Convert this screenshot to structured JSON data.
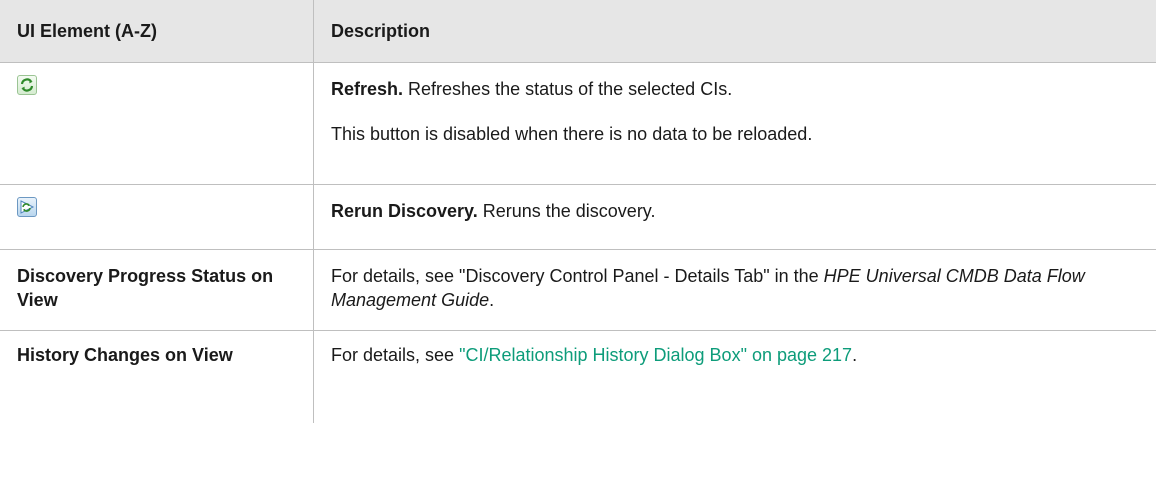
{
  "header": {
    "col1": "UI Element (A-Z)",
    "col2": "Description"
  },
  "rows": {
    "refresh": {
      "icon": "refresh-icon",
      "term": "Refresh.",
      "desc": " Refreshes the status of the selected CIs.",
      "note": "This button is disabled when there is no data to be reloaded."
    },
    "rerun": {
      "icon": "rerun-discovery-icon",
      "term": "Rerun Discovery.",
      "desc": " Reruns the discovery."
    },
    "progress": {
      "element": "Discovery Progress Status on View",
      "desc_before": "For details, see \"Discovery Control Panel - Details Tab\" in the ",
      "guide": "HPE Universal CMDB Data Flow Management Guide",
      "desc_after": "."
    },
    "history": {
      "element": "History Changes on View",
      "desc_before": "For details, see ",
      "link": "\"CI/Relationship History Dialog Box\" on page 217",
      "desc_after": "."
    }
  },
  "colors": {
    "header_bg": "#e6e6e6",
    "border": "#bfbfbf",
    "link": "#0d9c7a"
  }
}
